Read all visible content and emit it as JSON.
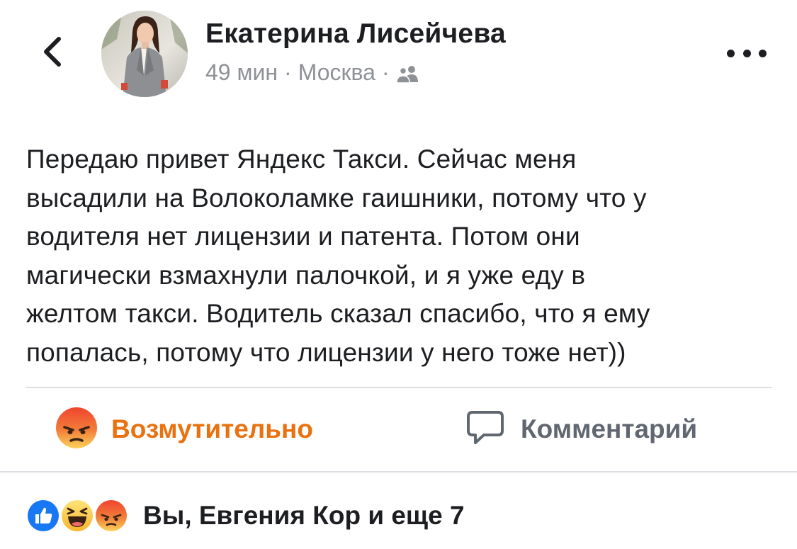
{
  "header": {
    "back_icon": "chevron-left-icon",
    "author_name": "Екатерина Лисейчева",
    "time": "49 мин",
    "separator": "·",
    "location": "Москва",
    "audience_icon": "friends-icon",
    "more_icon": "more-horizontal-icon"
  },
  "post": {
    "text_lines": [
      "Передаю привет Яндекс Такси. Сейчас меня",
      "высадили на Волоколамке гаишники, потому что у",
      "водителя нет лицензии и патента. Потом они",
      "магически взмахнули палочкой, и я уже еду в",
      "желтом такси. Водитель сказал спасибо, что я ему",
      "попалась, потому что лицензии у него тоже нет))"
    ]
  },
  "actions": {
    "reaction": {
      "icon": "angry-reaction-icon",
      "label": "Возмутительно",
      "color": "#e9710f"
    },
    "comment": {
      "icon": "comment-icon",
      "label": "Комментарий",
      "color": "#606770"
    }
  },
  "reactions_summary": {
    "icons": [
      "like-reaction-icon",
      "haha-reaction-icon",
      "angry-reaction-icon"
    ],
    "text": "Вы, Евгения Кор и еще 7"
  },
  "colors": {
    "text_primary": "#1c1e21",
    "text_secondary": "#8e9196",
    "divider": "#dadde1",
    "like_blue": "#1877f2",
    "angry_orange": "#e9710f"
  }
}
